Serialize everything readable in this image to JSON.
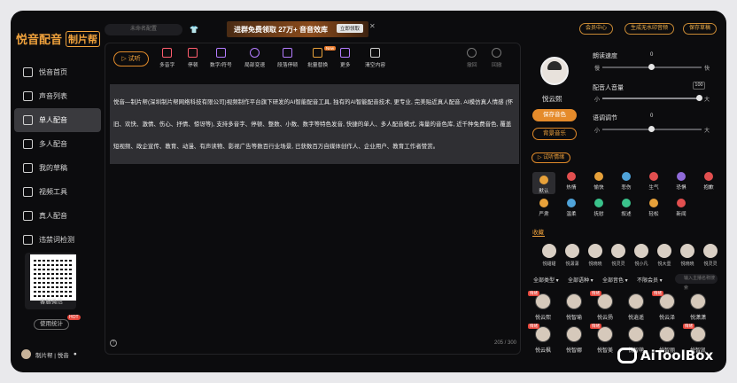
{
  "app": {
    "brand": "悦音配音",
    "brand2": "制片帮"
  },
  "sidebar": {
    "items": [
      {
        "label": "悦音首页"
      },
      {
        "label": "声音列表"
      },
      {
        "label": "单人配音"
      },
      {
        "label": "多人配音"
      },
      {
        "label": "我的草稿"
      },
      {
        "label": "视频工具"
      },
      {
        "label": "真人配音"
      },
      {
        "label": "违禁词检测"
      }
    ],
    "qr_caption": "客服微信",
    "usage_label": "使用统计",
    "hot_badge": "HOT",
    "user_name": "制片帮 | 悦音"
  },
  "topbar": {
    "project_name": "未命名配置",
    "banner_text": "进群免费领取 27万+ 音音效库",
    "banner_button": "立即领取",
    "member_center": "会员中心",
    "generate_no_watermark": "生成无水印音频",
    "save_draft": "保存草稿"
  },
  "toolbar": {
    "listen": "试听",
    "tools": [
      {
        "label": "多音字"
      },
      {
        "label": "停顿"
      },
      {
        "label": "数字/符号"
      },
      {
        "label": "局部变速"
      },
      {
        "label": "段落停顿"
      },
      {
        "label": "批量替换"
      },
      {
        "label": "更多"
      },
      {
        "label": "清空内容"
      }
    ],
    "new_badge": "New",
    "undo": "撤回",
    "redo": "回撤"
  },
  "editor": {
    "text": "悦音—制片帮(深圳制片帮网络科技有限公司)视频制作平台旗下研发的AI智能配音工具, 独有的AI智能配音技术, 更专业, 完美贴近真人配音, AI模仿真人情感 (怀旧、欢快、激情、伤心、抒情、惊讶等), 支持多音字、停顿、整数、小数、数字等特色发音, 快捷的单人、多人配音模式, 海量的音色库, 近千种免费音色, 覆盖短视频、政企宣传、教育、动漫、有声读物、影视广告等数百行业场景, 已获数百万自媒体创作人、企业用户、教育工作者赞赏。",
    "counter": "205 / 300"
  },
  "voice_panel": {
    "voice_name": "悦云熙",
    "save_voice": "保存音色",
    "bg_music": "背景音乐",
    "speed": {
      "title": "朗读速度",
      "value": "0",
      "min_label": "慢",
      "max_label": "快",
      "level": 0.5
    },
    "volume": {
      "title": "配音人音量",
      "value": "100",
      "min_label": "小",
      "max_label": "大",
      "level": 0.95
    },
    "pitch": {
      "title": "语调调节",
      "value": "0",
      "min_label": "小",
      "max_label": "大",
      "level": 0.5
    },
    "emotion_button": "试听情绪",
    "emotions": [
      {
        "label": "默认",
        "color": "#e7a13a"
      },
      {
        "label": "热情",
        "color": "#e24f4f"
      },
      {
        "label": "愉快",
        "color": "#e7a13a"
      },
      {
        "label": "悲伤",
        "color": "#4fa3d9"
      },
      {
        "label": "生气",
        "color": "#e24f4f"
      },
      {
        "label": "恐惧",
        "color": "#8f6ad8"
      },
      {
        "label": "抱歉",
        "color": "#e24f4f"
      },
      {
        "label": "严肃",
        "color": "#e7a13a"
      },
      {
        "label": "温柔",
        "color": "#4fa3d9"
      },
      {
        "label": "抚慰",
        "color": "#3ac28b"
      },
      {
        "label": "叙述",
        "color": "#3ac28b"
      },
      {
        "label": "轻松",
        "color": "#e7a13a"
      },
      {
        "label": "新闻",
        "color": "#e24f4f"
      }
    ],
    "favorites_title": "收藏",
    "favorites": [
      {
        "label": "悦甜甜"
      },
      {
        "label": "悦潇潇"
      },
      {
        "label": "悦晓晓"
      },
      {
        "label": "悦灵灵"
      },
      {
        "label": "悦小凡"
      },
      {
        "label": "悦大壹"
      },
      {
        "label": "悦晓晓"
      },
      {
        "label": "悦灵灵"
      }
    ],
    "filters": [
      "全部类型",
      "全部语种",
      "全部音色",
      "不限会员"
    ],
    "search_placeholder": "输入主播名称搜索",
    "voices": [
      {
        "label": "悦云熙",
        "tag": "情绪"
      },
      {
        "label": "悦智瑜",
        "tag": ""
      },
      {
        "label": "悦云扬",
        "tag": "情绪"
      },
      {
        "label": "悦逍遥",
        "tag": ""
      },
      {
        "label": "悦云泽",
        "tag": "情绪"
      },
      {
        "label": "悦潇潇",
        "tag": ""
      },
      {
        "label": "悦云枫",
        "tag": "情绪"
      },
      {
        "label": "悦智娜",
        "tag": ""
      },
      {
        "label": "悦智美",
        "tag": "情绪"
      },
      {
        "label": "悦智萌",
        "tag": ""
      },
      {
        "label": "悦智丽",
        "tag": ""
      },
      {
        "label": "悦智凯",
        "tag": "情绪"
      }
    ]
  },
  "watermark": "AiToolBox"
}
